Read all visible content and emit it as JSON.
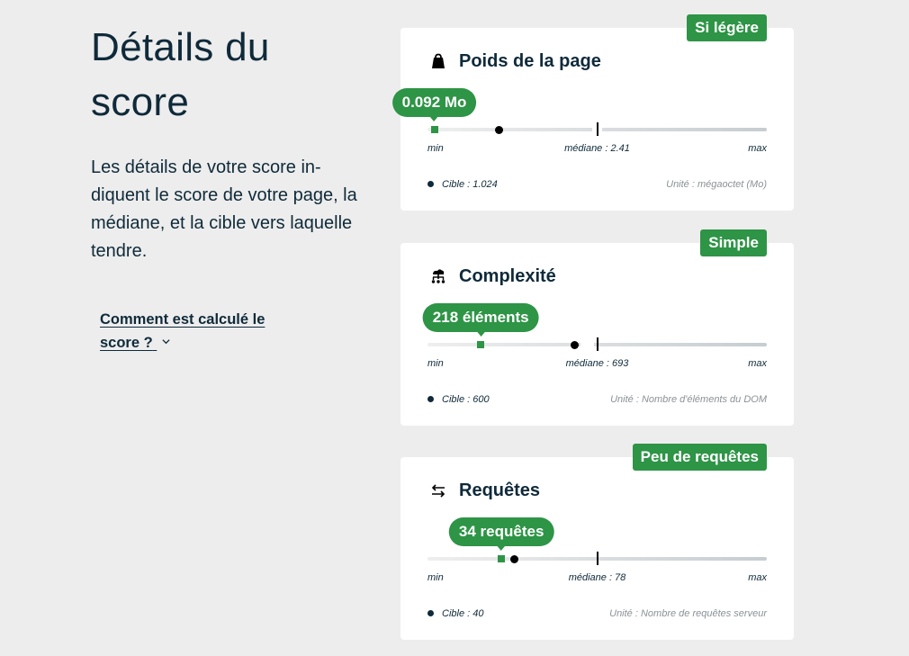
{
  "left": {
    "title": "Détails du score",
    "description": "Les détails de votre score in-diquent le score de votre page, la médiane, et la cible vers laquelle tendre.",
    "how_link": "Comment est calculé le score ?"
  },
  "scale_labels": {
    "min": "min",
    "max": "max"
  },
  "accent_color": "#2e9446",
  "cards": [
    {
      "badge": "Si légère",
      "icon": "weight-icon",
      "title": "Poids de la page",
      "value_label": "0.092 Mo",
      "median_label": "médiane : 2.41",
      "target_label": "Cible : 1.024",
      "unit_label": "Unité : mégaoctet (Mo)",
      "value_position": 0.02,
      "target_position": 0.21,
      "median_position": 0.5
    },
    {
      "badge": "Simple",
      "icon": "dom-tree-icon",
      "title": "Complexité",
      "value_label": "218 éléments",
      "median_label": "médiane : 693",
      "target_label": "Cible : 600",
      "unit_label": "Unité : Nombre d'éléments du DOM",
      "value_position": 0.157,
      "target_position": 0.434,
      "median_position": 0.5
    },
    {
      "badge": "Peu de requêtes",
      "icon": "arrows-exchange-icon",
      "title": "Requêtes",
      "value_label": "34 requêtes",
      "median_label": "médiane : 78",
      "target_label": "Cible : 40",
      "unit_label": "Unité : Nombre de requêtes serveur",
      "value_position": 0.218,
      "target_position": 0.257,
      "median_position": 0.5
    }
  ]
}
